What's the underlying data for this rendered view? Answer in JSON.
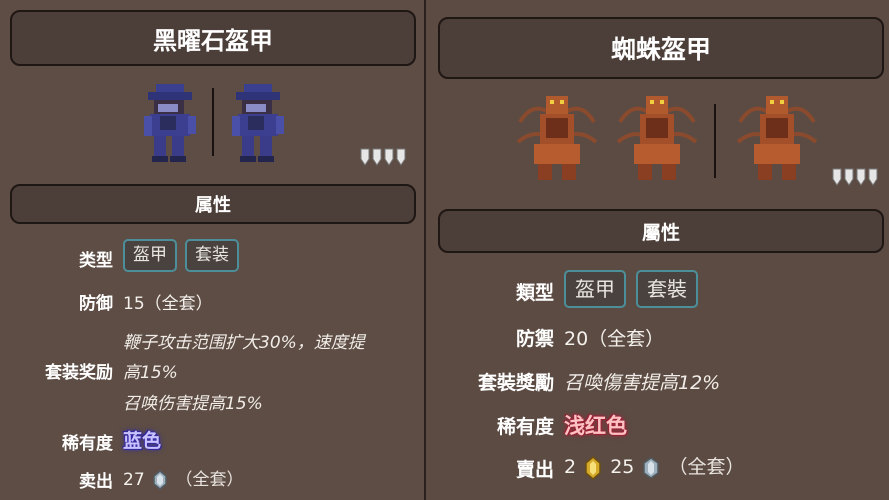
{
  "left": {
    "title": "黑曜石盔甲",
    "attr_title": "属性",
    "defense_icon_count": 4,
    "type_label": "类型",
    "type_tags": [
      "盔甲",
      "套装"
    ],
    "defense_label": "防御",
    "defense_value": "15（全套）",
    "bonus_label": "套装奖励",
    "bonus_line1": "鞭子攻击范围扩大30%，速度提",
    "bonus_line2": "高15%",
    "bonus_line3": "召唤伤害提高15%",
    "rarity_label": "稀有度",
    "rarity_value": "蓝色",
    "rarity_color": "#3a2fa8",
    "sell_label": "卖出",
    "sell_silver": "27",
    "sell_note": "（全套）"
  },
  "right": {
    "title": "蜘蛛盔甲",
    "attr_title": "屬性",
    "defense_icon_count": 4,
    "type_label": "類型",
    "type_tags": [
      "盔甲",
      "套裝"
    ],
    "defense_label": "防禦",
    "defense_value": "20（全套）",
    "bonus_label": "套裝獎勵",
    "bonus_line1": "召喚傷害提高12%",
    "rarity_label": "稀有度",
    "rarity_value": "浅红色",
    "rarity_color": "#a0263b",
    "sell_label": "賣出",
    "sell_gold": "2",
    "sell_silver": "25",
    "sell_note": "（全套）"
  },
  "colors": {
    "panel_bg": "#5d4d45",
    "box_border": "#1f1714",
    "tag_border": "#4c8f9a"
  }
}
